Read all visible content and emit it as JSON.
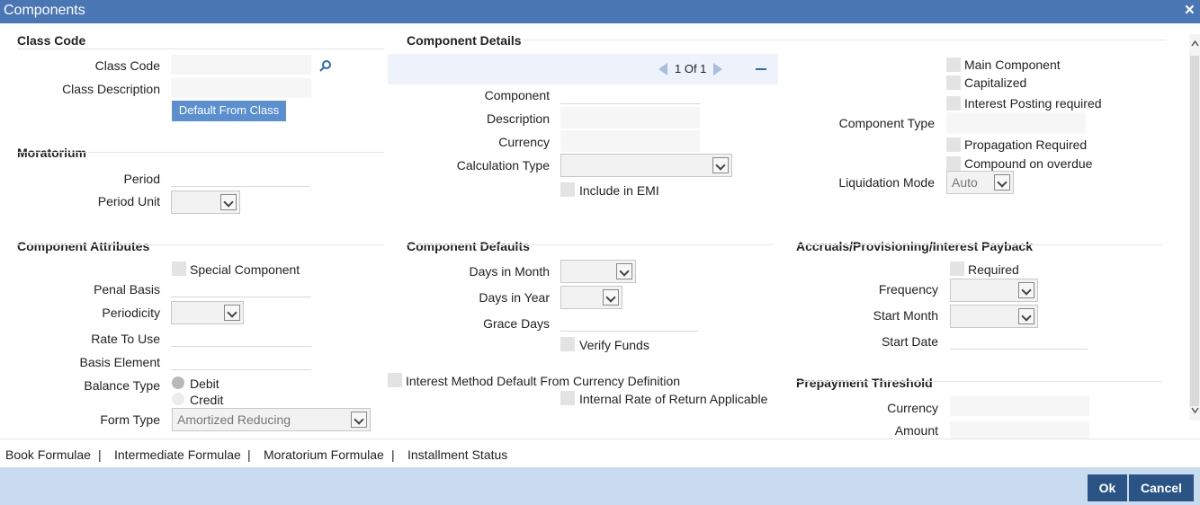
{
  "window": {
    "title": "Components",
    "close_icon": "×"
  },
  "class_code": {
    "heading": "Class Code",
    "class_code_label": "Class Code",
    "class_description_label": "Class Description",
    "default_button": "Default From Class"
  },
  "moratorium": {
    "heading": "Moratorium",
    "period_label": "Period",
    "period_unit_label": "Period Unit"
  },
  "component_details": {
    "heading": "Component Details",
    "pager_text": "1 Of  1",
    "component_label": "Component",
    "description_label": "Description",
    "currency_label": "Currency",
    "calculation_type_label": "Calculation Type",
    "include_emi_label": "Include in EMI"
  },
  "right_flags": {
    "main_component": "Main Component",
    "capitalized": "Capitalized",
    "interest_posting": "Interest Posting required",
    "component_type_label": "Component Type",
    "propagation": "Propagation Required",
    "compound_overdue": "Compound on overdue",
    "liquidation_mode_label": "Liquidation Mode",
    "liquidation_mode_value": "Auto"
  },
  "component_attributes": {
    "heading": "Component Attributes",
    "special_component": "Special Component",
    "penal_basis_label": "Penal Basis",
    "periodicity_label": "Periodicity",
    "rate_to_use_label": "Rate To Use",
    "basis_element_label": "Basis Element",
    "balance_type_label": "Balance Type",
    "debit": "Debit",
    "credit": "Credit",
    "form_type_label": "Form Type",
    "form_type_value": "Amortized Reducing"
  },
  "component_defaults": {
    "heading": "Component Defaults",
    "days_in_month_label": "Days in Month",
    "days_in_year_label": "Days in Year",
    "grace_days_label": "Grace Days",
    "verify_funds": "Verify Funds",
    "interest_method_default": "Interest Method Default From Currency Definition",
    "irr_applicable": "Internal Rate of Return Applicable"
  },
  "accruals": {
    "heading": "Accruals/Provisioning/Interest Payback",
    "required": "Required",
    "frequency_label": "Frequency",
    "start_month_label": "Start Month",
    "start_date_label": "Start Date"
  },
  "prepayment": {
    "heading": "Prepayment Threshold",
    "currency_label": "Currency",
    "amount_label": "Amount"
  },
  "footer_tabs": {
    "book_formulae": "Book Formulae",
    "intermediate_formulae": "Intermediate Formulae",
    "moratorium_formulae": "Moratorium Formulae",
    "installment_status": "Installment Status",
    "separator": "|"
  },
  "buttons": {
    "ok": "Ok",
    "cancel": "Cancel"
  },
  "colors": {
    "titlebar": "#4a76b4",
    "bottombar": "#c9dbee",
    "primary_button": "#2b5486",
    "default_button": "#5b8fd0"
  }
}
